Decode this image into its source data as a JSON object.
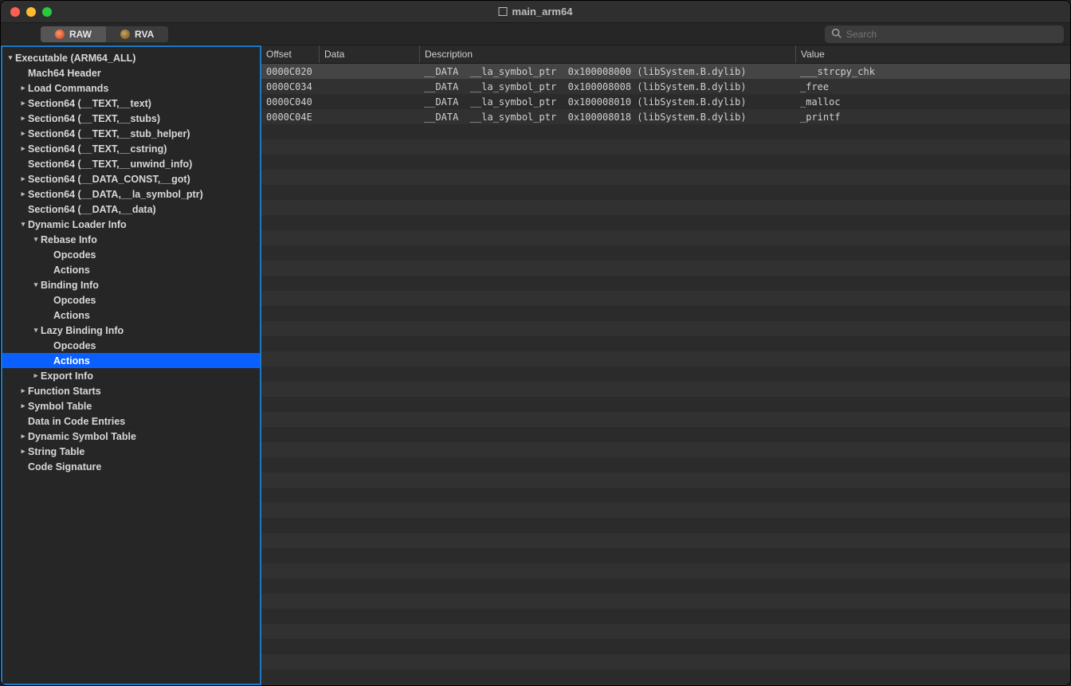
{
  "window": {
    "title": "main_arm64"
  },
  "toolbar": {
    "tabs": [
      {
        "label": "RAW",
        "active": true
      },
      {
        "label": "RVA",
        "active": false
      }
    ],
    "search_placeholder": "Search"
  },
  "tree": [
    {
      "indent": 0,
      "chev": "▾",
      "label": "Executable  (ARM64_ALL)"
    },
    {
      "indent": 1,
      "chev": "",
      "label": "Mach64 Header"
    },
    {
      "indent": 1,
      "chev": "▸",
      "label": "Load Commands"
    },
    {
      "indent": 1,
      "chev": "▸",
      "label": "Section64 (__TEXT,__text)"
    },
    {
      "indent": 1,
      "chev": "▸",
      "label": "Section64 (__TEXT,__stubs)"
    },
    {
      "indent": 1,
      "chev": "▸",
      "label": "Section64 (__TEXT,__stub_helper)"
    },
    {
      "indent": 1,
      "chev": "▸",
      "label": "Section64 (__TEXT,__cstring)"
    },
    {
      "indent": 1,
      "chev": "",
      "label": "Section64 (__TEXT,__unwind_info)"
    },
    {
      "indent": 1,
      "chev": "▸",
      "label": "Section64 (__DATA_CONST,__got)"
    },
    {
      "indent": 1,
      "chev": "▸",
      "label": "Section64 (__DATA,__la_symbol_ptr)"
    },
    {
      "indent": 1,
      "chev": "",
      "label": "Section64 (__DATA,__data)"
    },
    {
      "indent": 1,
      "chev": "▾",
      "label": "Dynamic Loader Info"
    },
    {
      "indent": 2,
      "chev": "▾",
      "label": "Rebase Info"
    },
    {
      "indent": 3,
      "chev": "",
      "label": "Opcodes"
    },
    {
      "indent": 3,
      "chev": "",
      "label": "Actions"
    },
    {
      "indent": 2,
      "chev": "▾",
      "label": "Binding Info"
    },
    {
      "indent": 3,
      "chev": "",
      "label": "Opcodes"
    },
    {
      "indent": 3,
      "chev": "",
      "label": "Actions"
    },
    {
      "indent": 2,
      "chev": "▾",
      "label": "Lazy Binding Info"
    },
    {
      "indent": 3,
      "chev": "",
      "label": "Opcodes"
    },
    {
      "indent": 3,
      "chev": "",
      "label": "Actions",
      "selected": true
    },
    {
      "indent": 2,
      "chev": "▸",
      "label": "Export Info"
    },
    {
      "indent": 1,
      "chev": "▸",
      "label": "Function Starts"
    },
    {
      "indent": 1,
      "chev": "▸",
      "label": "Symbol Table"
    },
    {
      "indent": 1,
      "chev": "",
      "label": "Data in Code Entries"
    },
    {
      "indent": 1,
      "chev": "▸",
      "label": "Dynamic Symbol Table"
    },
    {
      "indent": 1,
      "chev": "▸",
      "label": "String Table"
    },
    {
      "indent": 1,
      "chev": "",
      "label": "Code Signature"
    }
  ],
  "columns": {
    "offset": "Offset",
    "data": "Data",
    "description": "Description",
    "value": "Value"
  },
  "rows": [
    {
      "offset": "0000C020",
      "data": "",
      "desc": "__DATA  __la_symbol_ptr  0x100008000 (libSystem.B.dylib)",
      "value": "___strcpy_chk",
      "selected": true
    },
    {
      "offset": "0000C034",
      "data": "",
      "desc": "__DATA  __la_symbol_ptr  0x100008008 (libSystem.B.dylib)",
      "value": "_free"
    },
    {
      "offset": "0000C040",
      "data": "",
      "desc": "__DATA  __la_symbol_ptr  0x100008010 (libSystem.B.dylib)",
      "value": "_malloc"
    },
    {
      "offset": "0000C04E",
      "data": "",
      "desc": "__DATA  __la_symbol_ptr  0x100008018 (libSystem.B.dylib)",
      "value": "_printf"
    }
  ]
}
